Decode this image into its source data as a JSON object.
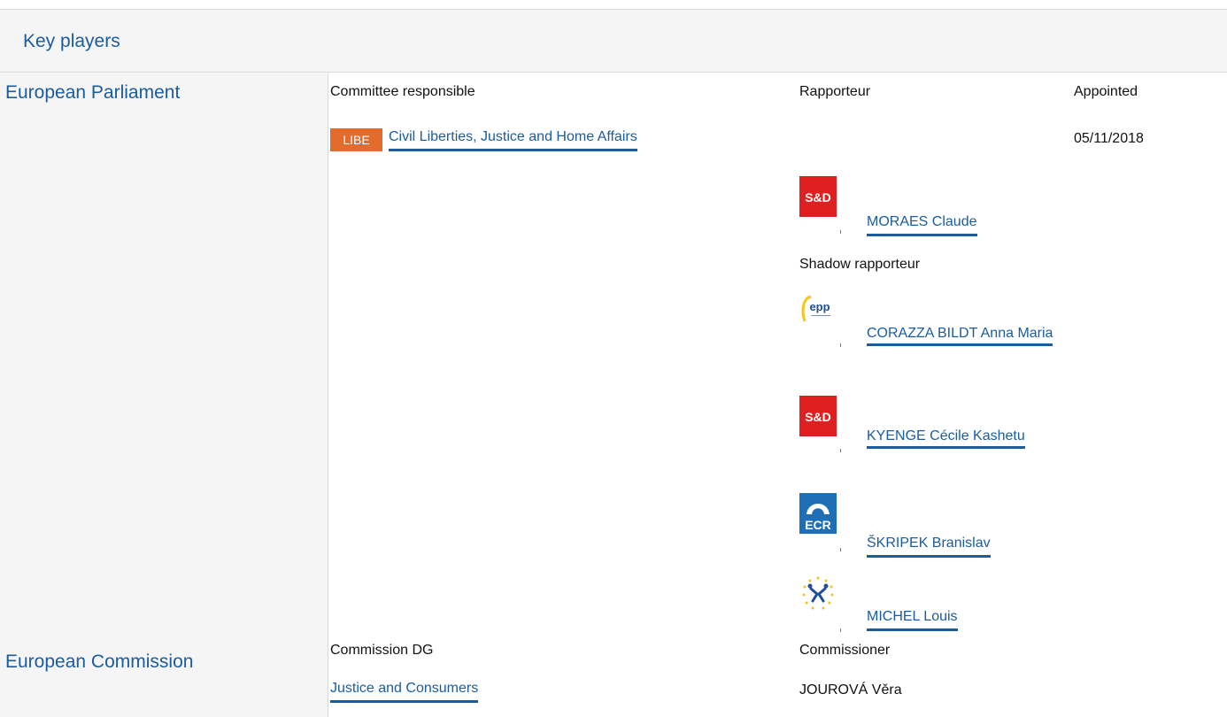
{
  "header": {
    "title": "Key players"
  },
  "colors": {
    "link": "#1a5c9e",
    "libe_badge": "#e36c2c",
    "sd_red": "#e02020",
    "ecr_blue": "#1e6fb5",
    "panel_bg": "#f5f5f5"
  },
  "parliament": {
    "title": "European Parliament",
    "col_committee": "Committee responsible",
    "col_rapporteur": "Rapporteur",
    "col_appointed": "Appointed",
    "committee_abbr": "LIBE",
    "committee_name": "Civil Liberties, Justice and Home Affairs",
    "appointed_date": "05/11/2018",
    "rapporteur": {
      "group_logo": "S&D",
      "name": "MORAES Claude"
    },
    "shadow_label": "Shadow rapporteur",
    "shadows": [
      {
        "group_logo": "epp",
        "name": "CORAZZA BILDT Anna Maria"
      },
      {
        "group_logo": "S&D",
        "name": "KYENGE Cécile Kashetu"
      },
      {
        "group_logo": "ECR",
        "name": "ŠKRIPEK Branislav"
      },
      {
        "group_logo": "efdd-icon",
        "name": "MICHEL Louis"
      }
    ]
  },
  "commission": {
    "title": "European Commission",
    "col_dg": "Commission DG",
    "col_commissioner": "Commissioner",
    "dg_name": "Justice and Consumers",
    "commissioner_name": "JOUROVÁ Věra"
  }
}
